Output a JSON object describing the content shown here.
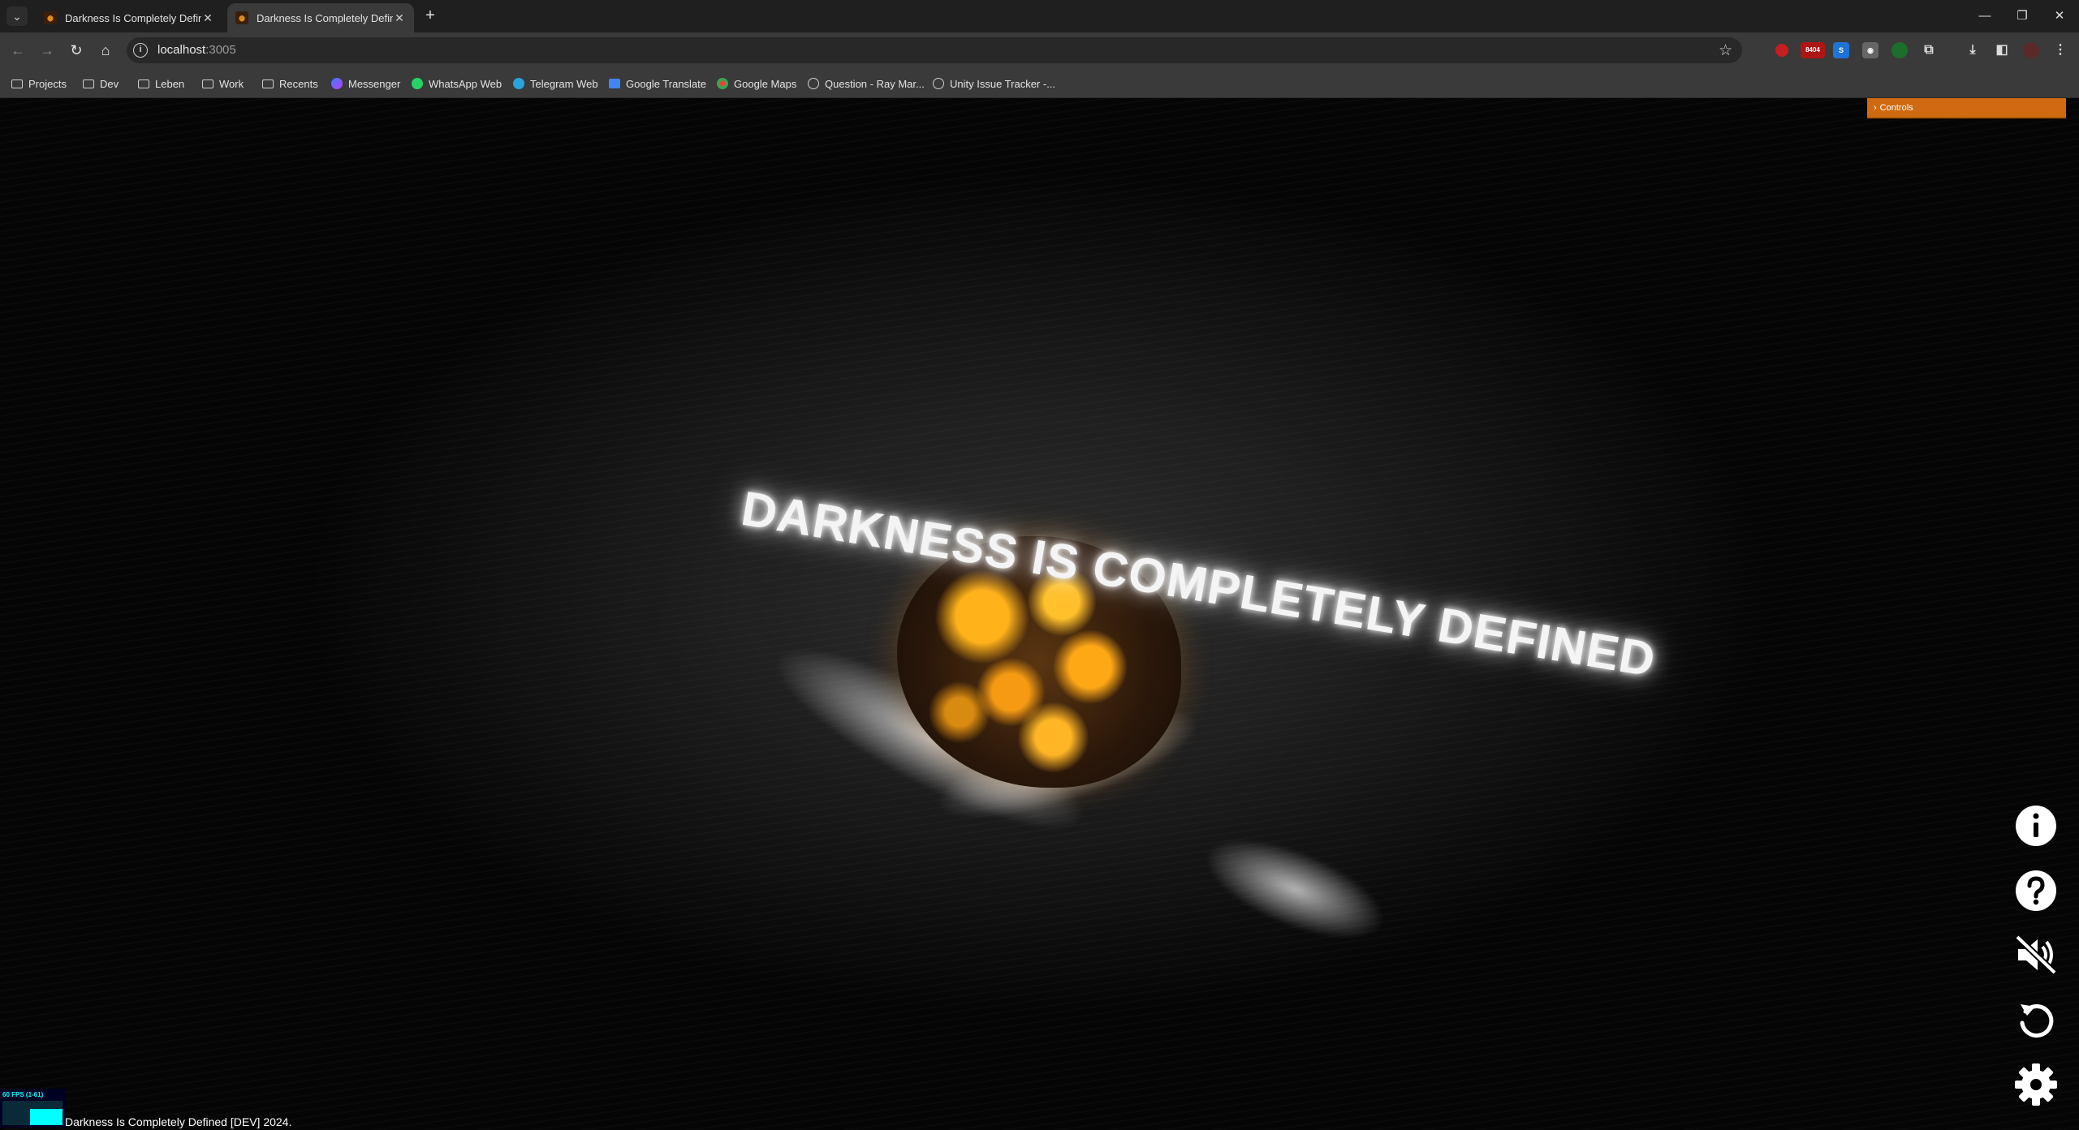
{
  "browser": {
    "tabs": [
      {
        "title": "Darkness Is Completely Defined",
        "close": "✕"
      },
      {
        "title": "Darkness Is Completely Defined",
        "close": "✕"
      }
    ],
    "new_tab": "+",
    "window": {
      "minimize": "—",
      "restore": "❐",
      "close": "✕"
    },
    "url_host": "localhost",
    "url_port": ":3005",
    "extension_badge": "8404",
    "bookmarks": [
      {
        "label": "Projects",
        "icon": "folder-icon"
      },
      {
        "label": "Dev",
        "icon": "folder-icon"
      },
      {
        "label": "Leben",
        "icon": "folder-icon"
      },
      {
        "label": "Work",
        "icon": "folder-icon"
      },
      {
        "label": "Recents",
        "icon": "folder-icon"
      },
      {
        "label": "Messenger",
        "icon": "messenger-icon"
      },
      {
        "label": "WhatsApp Web",
        "icon": "whatsapp-icon"
      },
      {
        "label": "Telegram Web",
        "icon": "telegram-icon"
      },
      {
        "label": "Google Translate",
        "icon": "translate-icon"
      },
      {
        "label": "Google Maps",
        "icon": "maps-icon"
      },
      {
        "label": "Question - Ray Mar...",
        "icon": "unity-icon"
      },
      {
        "label": "Unity Issue Tracker -...",
        "icon": "unity-icon"
      }
    ]
  },
  "page": {
    "controls_label": "Controls",
    "scene_title": "DARKNESS IS COMPLETELY DEFINED",
    "fps_label": "60 FPS (1-61)",
    "footer": "Darkness Is Completely Defined [DEV] 2024.",
    "side_buttons": [
      "info-icon",
      "help-icon",
      "mute-icon",
      "restart-icon",
      "settings-icon"
    ]
  },
  "colors": {
    "controls": "#cf6a12",
    "fps_text": "#00ffff",
    "lava": "#ffb21a"
  }
}
